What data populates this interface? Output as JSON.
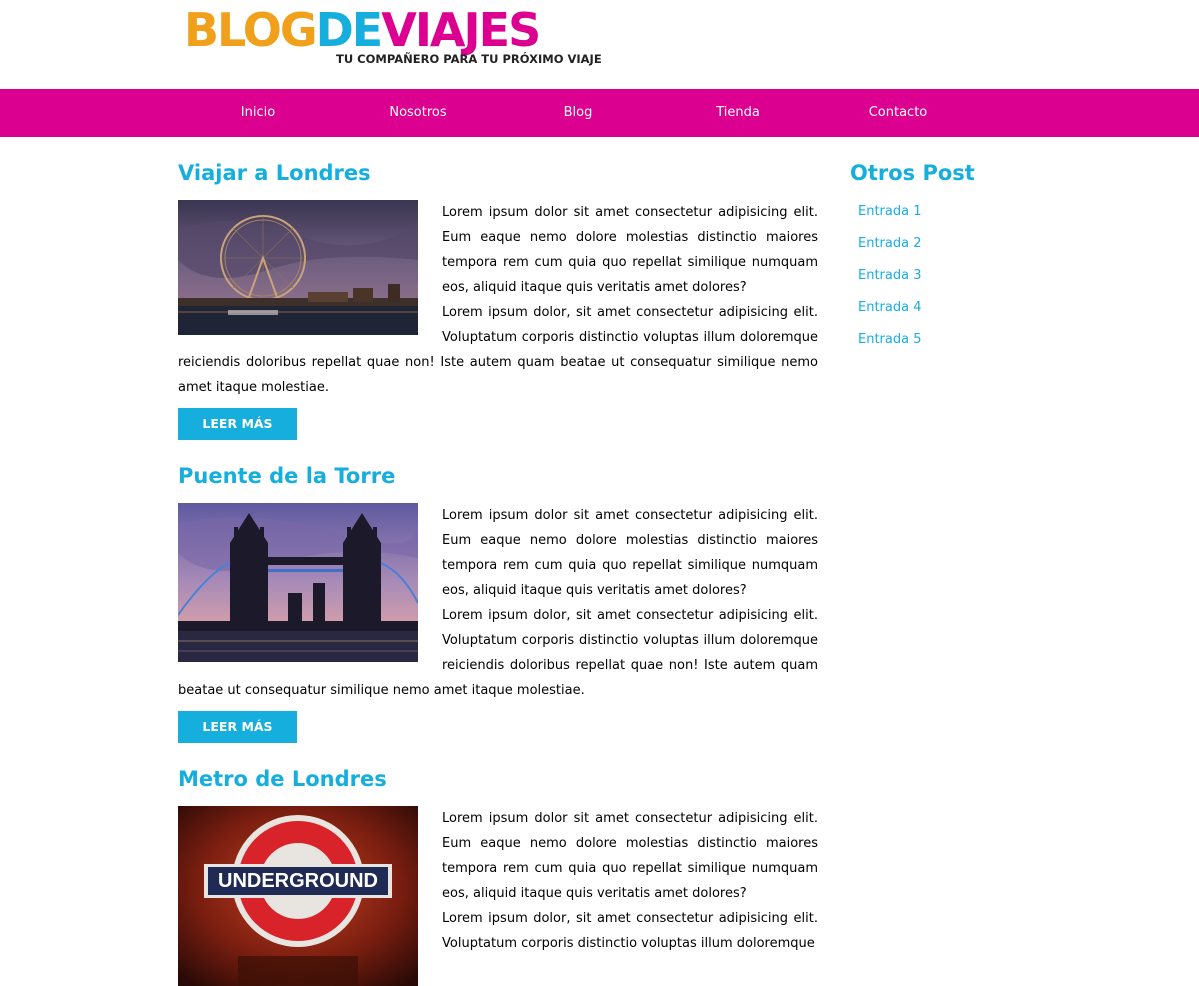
{
  "logo": {
    "part1": "BLOG",
    "part2": "DE",
    "part3": "VIAJES",
    "tagline": "TU COMPAÑERO PARA TU PRÓXIMO VIAJE"
  },
  "nav": {
    "items": [
      "Inicio",
      "Nosotros",
      "Blog",
      "Tienda",
      "Contacto"
    ]
  },
  "colors": {
    "accent_blue": "#16aedc",
    "accent_pink": "#dc0091",
    "logo_orange": "#f0a01a"
  },
  "posts": [
    {
      "title": "Viajar a Londres",
      "image": "london-eye-photo",
      "para1": "Lorem ipsum dolor sit amet consectetur adipisicing elit. Eum eaque nemo dolore molestias distinctio maiores tempora rem cum quia quo repellat similique numquam eos, aliquid itaque quis veritatis amet dolores?",
      "para2": "Lorem ipsum dolor, sit amet consectetur adipisicing elit. Voluptatum corporis distinctio voluptas illum doloremque reiciendis doloribus repellat quae non! Iste autem quam beatae ut consequatur similique nemo amet itaque molestiae.",
      "button": "LEER MÁS"
    },
    {
      "title": "Puente de la Torre",
      "image": "tower-bridge-photo",
      "para1": "Lorem ipsum dolor sit amet consectetur adipisicing elit. Eum eaque nemo dolore molestias distinctio maiores tempora rem cum quia quo repellat similique numquam eos, aliquid itaque quis veritatis amet dolores?",
      "para2": "Lorem ipsum dolor, sit amet consectetur adipisicing elit. Voluptatum corporis distinctio voluptas illum doloremque reiciendis doloribus repellat quae non! Iste autem quam beatae ut consequatur similique nemo amet itaque molestiae.",
      "button": "LEER MÁS"
    },
    {
      "title": "Metro de Londres",
      "image": "underground-sign-photo",
      "image_text": "UNDERGROUND",
      "para1": "Lorem ipsum dolor sit amet consectetur adipisicing elit. Eum eaque nemo dolore molestias distinctio maiores tempora rem cum quia quo repellat similique numquam eos, aliquid itaque quis veritatis amet dolores?",
      "para2": "Lorem ipsum dolor, sit amet consectetur adipisicing elit. Voluptatum corporis distinctio voluptas illum doloremque"
    }
  ],
  "sidebar": {
    "title": "Otros Post",
    "items": [
      "Entrada 1",
      "Entrada 2",
      "Entrada 3",
      "Entrada 4",
      "Entrada 5"
    ]
  }
}
